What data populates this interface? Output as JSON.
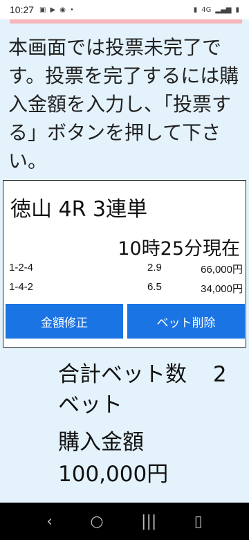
{
  "status_bar": {
    "time": "10:27",
    "icons": [
      "image-icon",
      "play-icon",
      "cast-icon",
      "dot-icon"
    ],
    "right_icons": [
      "battery-saver-icon",
      "4g-icon",
      "signal-icon",
      "battery-icon"
    ]
  },
  "notice": {
    "text": "本画面では投票未完了です。投票を完了するには購入金額を入力し、「投票する」ボタンを押して下さい。"
  },
  "card": {
    "title": "徳山 4R 3連単",
    "as_of": "10時25分現在",
    "bets": [
      {
        "combo": "1-2-4",
        "odds": "2.9",
        "amount": "66,000円"
      },
      {
        "combo": "1-4-2",
        "odds": "6.5",
        "amount": "34,000円"
      }
    ],
    "edit_button": "金額修正",
    "delete_button": "ベット削除"
  },
  "summary": {
    "total_bets_label": "合計ベット数",
    "total_bets_value": "2",
    "bets_unit": "ベット",
    "purchase_label": "購入金額",
    "purchase_value": "100,000円"
  },
  "nav": {
    "back": "‹",
    "home": "○",
    "recents": "|||"
  },
  "colors": {
    "background": "#e3f2fb",
    "accent": "#1b74e4",
    "pink_bar": "#f5b6be"
  }
}
